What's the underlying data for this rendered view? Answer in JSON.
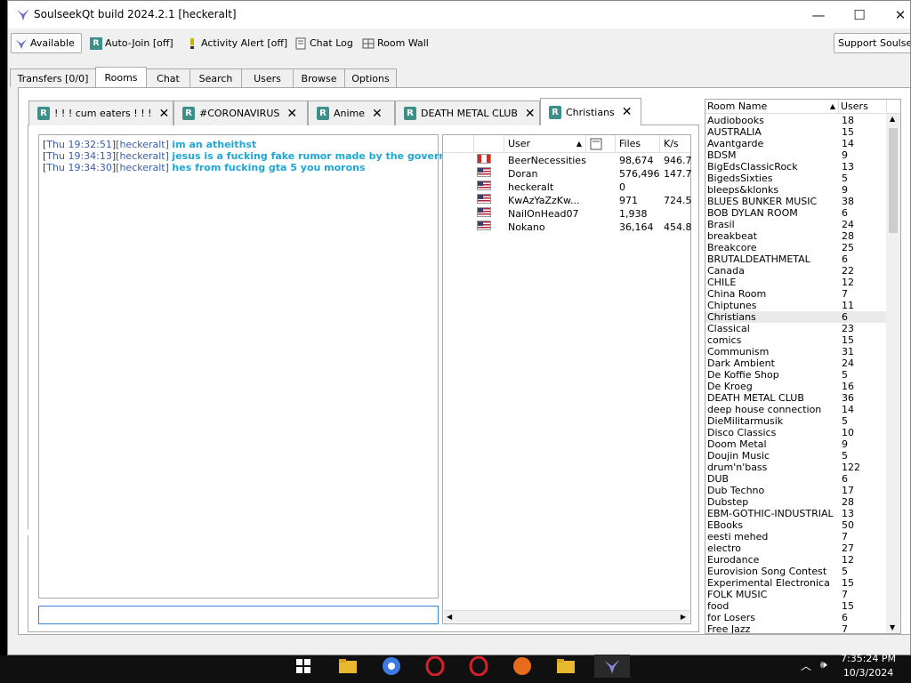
{
  "window": {
    "title": "SoulseekQt build 2024.2.1 [heckeralt]",
    "controls": {
      "minimize": "—",
      "maximize": "☐",
      "close": "✕"
    }
  },
  "toolbar": {
    "status_label": "Available",
    "autojoin_label": "Auto-Join [off]",
    "activity_alert_label": "Activity Alert [off]",
    "chat_log_label": "Chat Log",
    "room_wall_label": "Room Wall",
    "support_label": "Support Soulseek"
  },
  "main_tabs": [
    "Transfers [0/0]",
    "Rooms",
    "Chat",
    "Search",
    "Users",
    "Browse",
    "Options"
  ],
  "room_tabs": [
    {
      "badge": "R",
      "label": "! ! ! cum eaters ! ! !"
    },
    {
      "badge": "R",
      "label": "#CORONAVIRUS"
    },
    {
      "badge": "R",
      "label": "Anime"
    },
    {
      "badge": "R",
      "label": "DEATH METAL CLUB"
    },
    {
      "badge": "R",
      "label": "Christians"
    }
  ],
  "chat": {
    "lines": [
      {
        "time": "Thu 19:32:51",
        "user": "heckeralt",
        "text": "im an atheithst"
      },
      {
        "time": "Thu 19:34:13",
        "user": "heckeralt",
        "text": "jesus is a fucking fake rumor made by the goverment"
      },
      {
        "time": "Thu 19:34:30",
        "user": "heckeralt",
        "text": "hes from fucking gta 5 you morons"
      }
    ],
    "input_value": ""
  },
  "userlist": {
    "headers": {
      "user": "User",
      "files": "Files",
      "speed": "K/s"
    },
    "rows": [
      {
        "flag": "ca",
        "user": "BeerNecessities",
        "files": "98,674",
        "speed": "946.7"
      },
      {
        "flag": "us",
        "user": "Doran",
        "files": "576,496",
        "speed": "147.7"
      },
      {
        "flag": "us",
        "user": "heckeralt",
        "files": "0",
        "speed": ""
      },
      {
        "flag": "us",
        "user": "KwAzYaZzKw...",
        "files": "971",
        "speed": "724.5"
      },
      {
        "flag": "us",
        "user": "NailOnHead07",
        "files": "1,938",
        "speed": ""
      },
      {
        "flag": "us",
        "user": "Nokano",
        "files": "36,164",
        "speed": "454.8"
      }
    ]
  },
  "roomlist": {
    "headers": {
      "name": "Room Name",
      "users": "Users"
    },
    "rows": [
      [
        "Audiobooks",
        "18"
      ],
      [
        "AUSTRALIA",
        "15"
      ],
      [
        "Avantgarde",
        "14"
      ],
      [
        "BDSM",
        "9"
      ],
      [
        "BigEdsClassicRock",
        "13"
      ],
      [
        "BigedsSixties",
        "5"
      ],
      [
        "bleeps&klonks",
        "9"
      ],
      [
        "BLUES BUNKER MUSIC",
        "38"
      ],
      [
        "BOB DYLAN ROOM",
        "6"
      ],
      [
        "Brasil",
        "24"
      ],
      [
        "breakbeat",
        "28"
      ],
      [
        "Breakcore",
        "25"
      ],
      [
        "BRUTALDEATHMETAL",
        "6"
      ],
      [
        "Canada",
        "22"
      ],
      [
        "CHILE",
        "12"
      ],
      [
        "China Room",
        "7"
      ],
      [
        "Chiptunes",
        "11"
      ],
      [
        "Christians",
        "6"
      ],
      [
        "Classical",
        "23"
      ],
      [
        "comics",
        "15"
      ],
      [
        "Communism",
        "31"
      ],
      [
        "Dark Ambient",
        "24"
      ],
      [
        "De Koffie Shop",
        "5"
      ],
      [
        "De Kroeg",
        "16"
      ],
      [
        "DEATH METAL CLUB",
        "36"
      ],
      [
        "deep house connection",
        "14"
      ],
      [
        "DieMilitarmusik",
        "5"
      ],
      [
        "Disco Classics",
        "10"
      ],
      [
        "Doom Metal",
        "9"
      ],
      [
        "Doujin Music",
        "5"
      ],
      [
        "drum'n'bass",
        "122"
      ],
      [
        "DUB",
        "6"
      ],
      [
        "Dub Techno",
        "17"
      ],
      [
        "Dubstep",
        "28"
      ],
      [
        "EBM-GOTHIC-INDUSTRIAL",
        "13"
      ],
      [
        "EBooks",
        "50"
      ],
      [
        "eesti mehed",
        "7"
      ],
      [
        "electro",
        "27"
      ],
      [
        "Eurodance",
        "12"
      ],
      [
        "Eurovision Song Contest",
        "5"
      ],
      [
        "Experimental Electronica",
        "15"
      ],
      [
        "FOLK MUSIC",
        "7"
      ],
      [
        "food",
        "15"
      ],
      [
        "for Losers",
        "6"
      ],
      [
        "Free Jazz",
        "7"
      ]
    ],
    "selected": "Christians"
  },
  "taskbar": {
    "time": "7:35:24 PM",
    "date": "10/3/2024"
  }
}
